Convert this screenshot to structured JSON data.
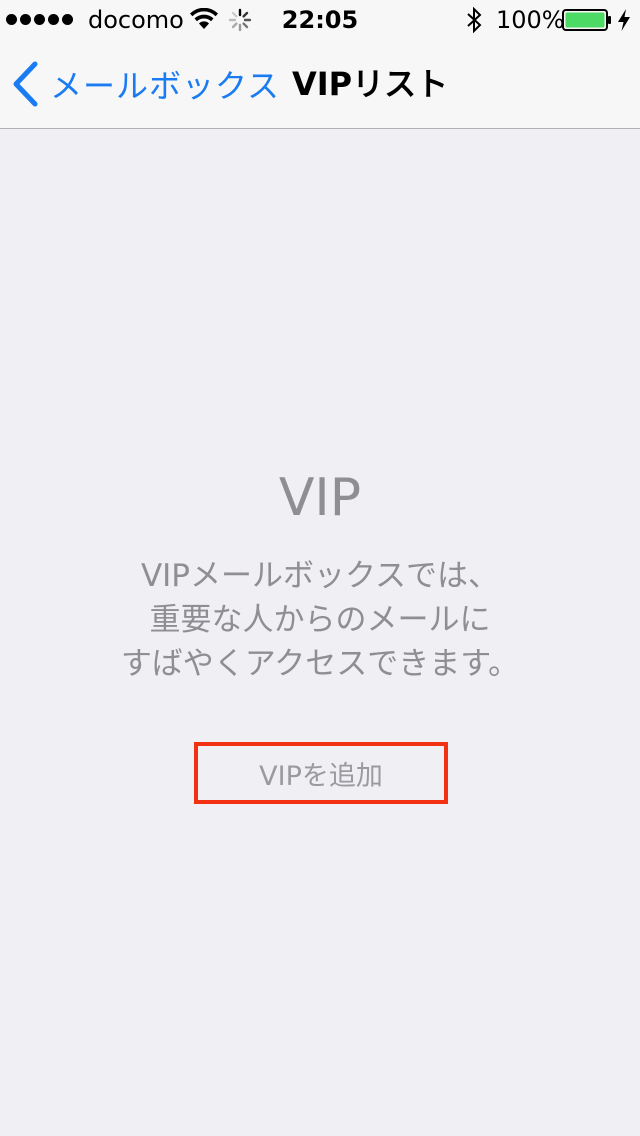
{
  "status_bar": {
    "carrier": "docomo",
    "time": "22:05",
    "battery_percent": "100%",
    "battery_level": 1.0,
    "signal_bars": 5,
    "icons": [
      "wifi-icon",
      "activity-indicator-icon",
      "bluetooth-icon",
      "battery-icon",
      "charging-icon"
    ]
  },
  "nav": {
    "back_label": "メールボックス",
    "title": "VIPリスト"
  },
  "empty_state": {
    "title": "VIP",
    "message_lines": [
      "VIPメールボックスでは、",
      "重要な人からのメールに",
      "すばやくアクセスできます。"
    ],
    "add_button_label": "VIPを追加"
  },
  "colors": {
    "accent": "#1a7cf0",
    "highlight_border": "#f23012",
    "secondary_text": "#8e8e93",
    "background": "#efeff4",
    "battery_fill": "#4cd964"
  }
}
